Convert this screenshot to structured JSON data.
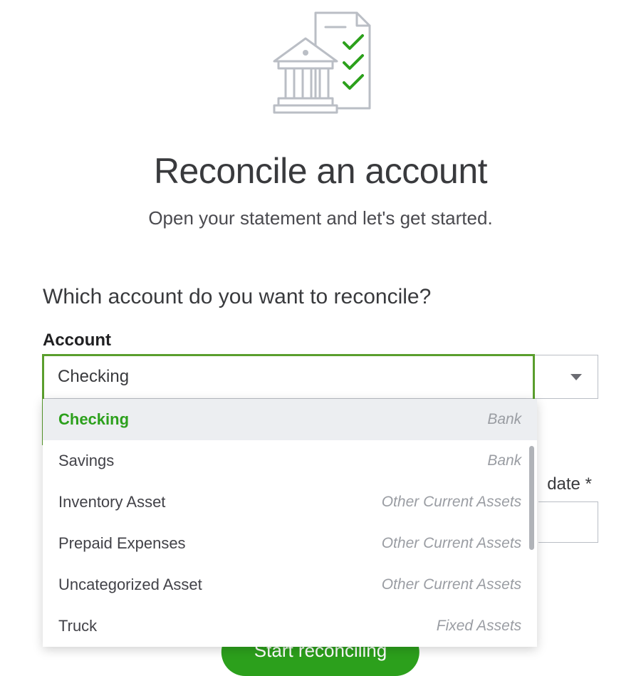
{
  "header": {
    "title": "Reconcile an account",
    "subtitle": "Open your statement and let's get started."
  },
  "question": "Which account do you want to reconcile?",
  "account_field": {
    "label": "Account",
    "value": "Checking",
    "options": [
      {
        "name": "Checking",
        "type": "Bank",
        "selected": true
      },
      {
        "name": "Savings",
        "type": "Bank",
        "selected": false
      },
      {
        "name": "Inventory Asset",
        "type": "Other Current Assets",
        "selected": false
      },
      {
        "name": "Prepaid Expenses",
        "type": "Other Current Assets",
        "selected": false
      },
      {
        "name": "Uncategorized Asset",
        "type": "Other Current Assets",
        "selected": false
      },
      {
        "name": "Truck",
        "type": "Fixed Assets",
        "selected": false
      }
    ]
  },
  "background_field": {
    "label_fragment": "date *"
  },
  "primary_button": "Start reconciling"
}
